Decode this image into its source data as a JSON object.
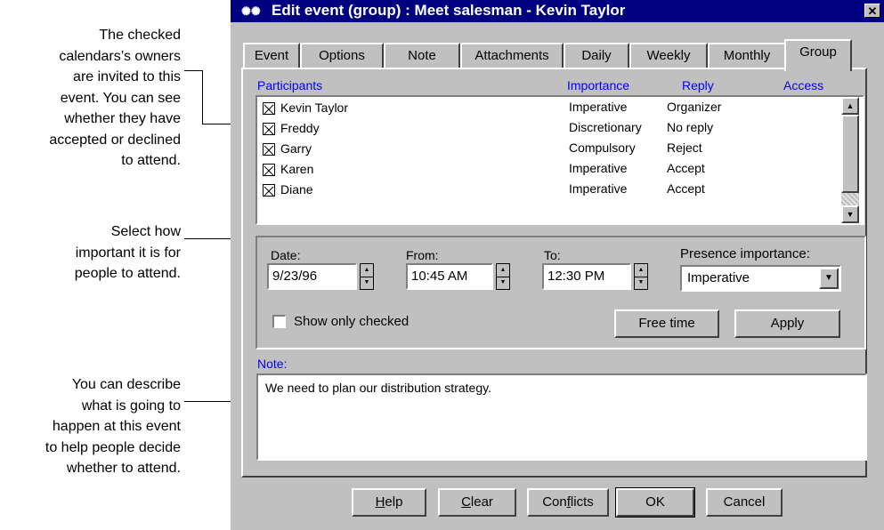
{
  "annotations": {
    "participants": [
      "The checked",
      "calendars’s owners",
      "are invited to this",
      "event. You can see",
      "whether they have",
      "accepted or declined",
      "to attend."
    ],
    "importance": [
      "Select how",
      "important it is for",
      "people to attend."
    ],
    "note": [
      "You can describe",
      "what is going to",
      "happen at this event",
      "to help people decide",
      "whether to attend."
    ]
  },
  "window": {
    "title": "Edit event (group) : Meet salesman - Kevin Taylor",
    "icon": "app-icon",
    "close_label": "✕"
  },
  "tabs": [
    "Event",
    "Options",
    "Note",
    "Attachments",
    "Daily",
    "Weekly",
    "Monthly",
    "Group"
  ],
  "active_tab": "Group",
  "participants": {
    "headers": {
      "participants": "Participants",
      "importance": "Importance",
      "reply": "Reply",
      "access": "Access"
    },
    "rows": [
      {
        "name": "Kevin Taylor",
        "importance": "Imperative",
        "reply": "Organizer",
        "checked": true
      },
      {
        "name": "Freddy",
        "importance": "Discretionary",
        "reply": "No reply",
        "checked": true
      },
      {
        "name": "Garry",
        "importance": "Compulsory",
        "reply": "Reject",
        "checked": true
      },
      {
        "name": "Karen",
        "importance": "Imperative",
        "reply": "Accept",
        "checked": true
      },
      {
        "name": "Diane",
        "importance": "Imperative",
        "reply": "Accept",
        "checked": true
      }
    ]
  },
  "fields": {
    "date_label": "Date:",
    "date_value": "9/23/96",
    "from_label": "From:",
    "from_value": "10:45 AM",
    "to_label": "To:",
    "to_value": "12:30 PM",
    "presence_label": "Presence  importance:",
    "presence_value": "Imperative",
    "show_checked_label": "Show only checked",
    "show_checked": false
  },
  "buttons": {
    "free_time": "Free time",
    "apply": "Apply"
  },
  "note": {
    "label": "Note:",
    "text": "We need to plan our distribution strategy."
  },
  "footer": {
    "help_u": "H",
    "help_rest": "elp",
    "clear_u": "C",
    "clear_rest": "lear",
    "conflicts_pre": "Con",
    "conflicts_u": "f",
    "conflicts_rest": "licts",
    "ok": "OK",
    "cancel": "Cancel"
  },
  "colors": {
    "title_bar": "#000080",
    "header_text": "#0000ff",
    "face": "#c0c0c0"
  }
}
